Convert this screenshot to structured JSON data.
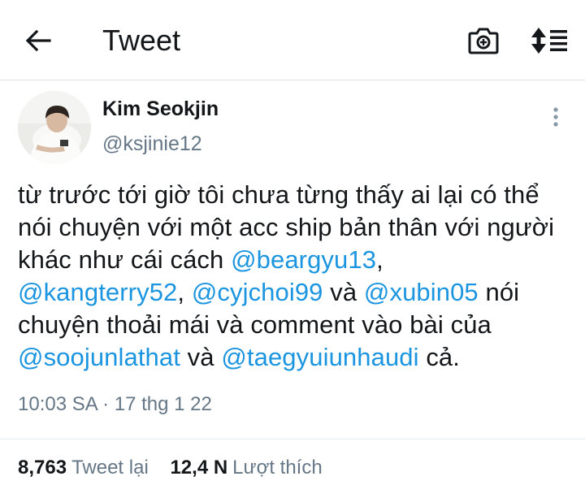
{
  "header": {
    "title": "Tweet",
    "icons": [
      "back-arrow-icon",
      "camera-icon",
      "sort-icon"
    ]
  },
  "tweet": {
    "author": {
      "display_name": "Kim Seokjin",
      "handle": "@ksjinie12"
    },
    "text_parts": [
      "từ trước tới giờ tôi chưa từng thấy ai lại có thể nói chuyện với một acc ship bản thân với người khác như cái cách ",
      "@beargyu13",
      ",\n",
      "@kangterry52",
      ", ",
      "@cyjchoi99",
      " và ",
      "@xubin05",
      " nói chuyện thoải mái và comment vào bài của\n",
      "@soojunlathat",
      " và ",
      "@taegyuiunhaudi",
      " cả."
    ],
    "timestamp": "10:03 SA · 17 thg 1 22",
    "stats": {
      "retweets_count": "8,763",
      "retweets_label": "Tweet lại",
      "likes_count": "12,4 N",
      "likes_label": "Lượt thích"
    }
  },
  "colors": {
    "link": "#1b95e0",
    "secondary_text": "#657786",
    "divider": "#e6ecf0"
  }
}
